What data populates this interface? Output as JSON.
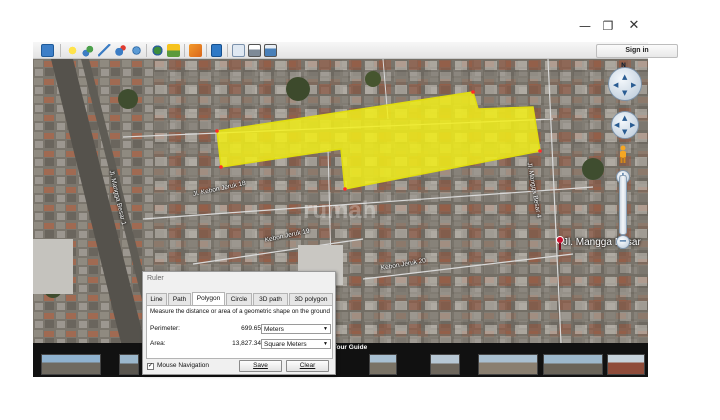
{
  "window": {
    "controls": {
      "minimize": "—",
      "maximize": "❐",
      "close": "✕"
    }
  },
  "toolbar": {
    "sign_in_label": "Sign in",
    "icons": [
      "sidebar-icon",
      "placemark-icon",
      "polygon-icon",
      "path-icon",
      "image-overlay-icon",
      "record-tour-icon",
      "historical-imagery-icon",
      "sunlight-icon",
      "planets-icon",
      "ruler-icon",
      "email-icon",
      "print-icon",
      "save-image-icon"
    ]
  },
  "map": {
    "streets": [
      {
        "label": "Jl. Mangga Besar 1"
      },
      {
        "label": "Jl. Kebon Jeruk 18"
      },
      {
        "label": "Kebon Jeruk 19"
      },
      {
        "label": "Kebon Jeruk 20"
      },
      {
        "label": "Jl. Mangga Besar 4"
      }
    ],
    "place_label": "Jl. Mangga Besar",
    "watermark": "rumah",
    "north_label": "N",
    "colors": {
      "polygon_fill": "#f2ef1a",
      "polygon_stroke": "#e0dc10",
      "vertex": "#ff2a2a",
      "pin": "#c8102e"
    }
  },
  "tour_guide": {
    "title": "Tour Guide"
  },
  "ruler": {
    "title": "Ruler",
    "tabs": [
      {
        "label": "Line"
      },
      {
        "label": "Path"
      },
      {
        "label": "Polygon",
        "active": true
      },
      {
        "label": "Circle"
      },
      {
        "label": "3D path"
      },
      {
        "label": "3D polygon"
      }
    ],
    "description": "Measure the distance or area of a geometric shape on the ground",
    "perimeter": {
      "label": "Perimeter:",
      "value": "699.65",
      "unit": "Meters"
    },
    "area": {
      "label": "Area:",
      "value": "13,827.34",
      "unit": "Square Meters"
    },
    "mouse_navigation": {
      "label": "Mouse Navigation",
      "checked": true,
      "mark": "✓"
    },
    "save_label": "Save",
    "clear_label": "Clear"
  }
}
